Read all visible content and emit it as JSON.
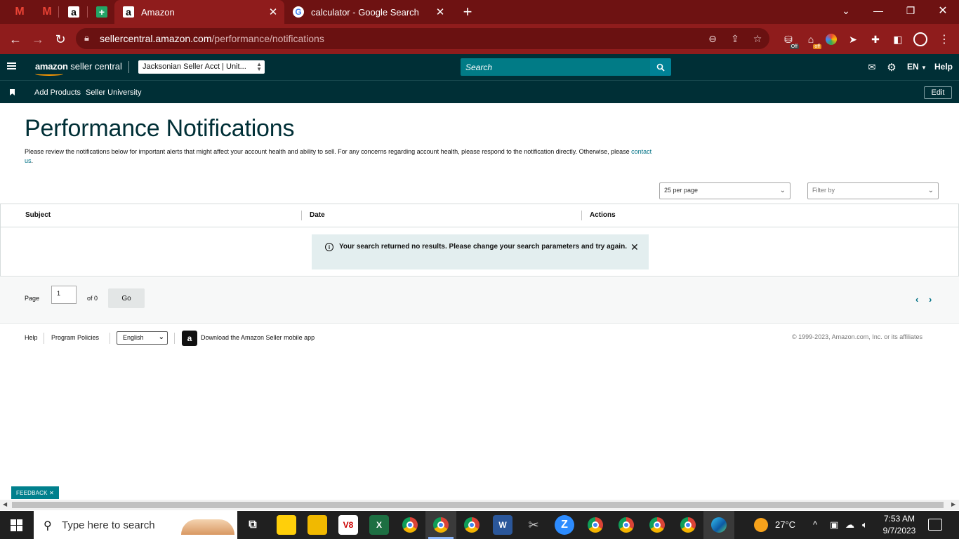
{
  "browser": {
    "tabs": [
      {
        "title": "Amazon",
        "close": "✕",
        "active": true
      },
      {
        "title": "calculator - Google Search",
        "close": "✕",
        "active": false
      }
    ],
    "new_tab": "+",
    "url_host": "sellercentral.amazon.com",
    "url_path": "/performance/notifications",
    "extension_badges": {
      "first": "Off",
      "second": "off"
    }
  },
  "seller_header": {
    "logo_brand": "amazon",
    "logo_product": " seller central",
    "account_select": "Jacksonian Seller Acct | Unit...",
    "search_placeholder": "Search",
    "language": "EN",
    "help": "Help"
  },
  "subnav": {
    "links": [
      "Add Products",
      "Seller University"
    ],
    "edit": "Edit"
  },
  "page": {
    "title": "Performance Notifications",
    "description": "Please review the notifications below for important alerts that might affect your account health and ability to sell. For any concerns regarding account health, please respond to the notification directly. Otherwise, please ",
    "contact_link": "contact us",
    "description_end": ".",
    "per_page": "25 per page",
    "filter_placeholder": "Filter by"
  },
  "table": {
    "columns": [
      "Subject",
      "Date",
      "Actions"
    ],
    "alert": {
      "icon": "i",
      "message": "Your search returned no results. Please change your search parameters and try again.",
      "close": "✕"
    }
  },
  "pager": {
    "page_label": "Page",
    "page_value": "1",
    "of_label": "of 0",
    "go": "Go"
  },
  "footer": {
    "help": "Help",
    "program_policies": "Program Policies",
    "language": "English",
    "download_app": "Download the Amazon Seller mobile app",
    "copyright": "© 1999-2023, Amazon.com, Inc. or its affiliates"
  },
  "feedback": "FEEDBACK ✕",
  "taskbar": {
    "search_placeholder": "Type here to search",
    "weather": "27°C",
    "time": "7:53 AM",
    "date": "9/7/2023"
  },
  "colors": {
    "browser_frame": "#8f1c1c",
    "seller_header": "#002f36",
    "search_box": "#017b86",
    "alert_bg": "#e3eeef",
    "link": "#007185",
    "feedback": "#00808d"
  }
}
